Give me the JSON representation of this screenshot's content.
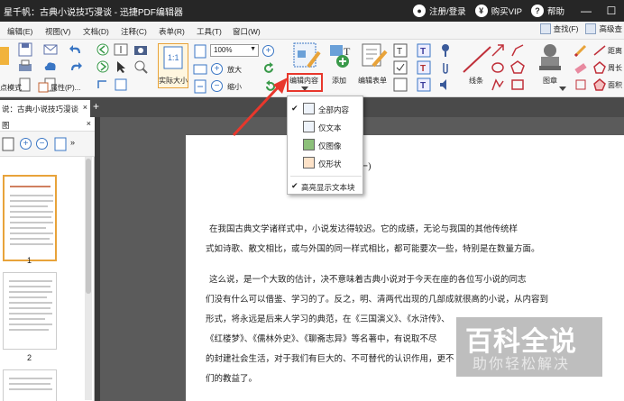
{
  "title_bar": {
    "title": "星千帆：古典小说技巧漫谈 - 迅捷PDF编辑器",
    "login": "注册/登录",
    "vip": "购买VIP",
    "help": "帮助",
    "minimize": "—",
    "maximize": "☐",
    "close": "✕"
  },
  "menu": {
    "items": [
      "编辑(E)",
      "视图(V)",
      "文档(D)",
      "注释(C)",
      "表单(R)",
      "工具(T)",
      "窗口(W)"
    ],
    "find": "查找(F)",
    "advanced_find": "高级查"
  },
  "ribbon": {
    "zoom_value": "100%",
    "zoom_in": "放大",
    "zoom_out": "缩小",
    "actual_size": "实际大小",
    "edit_content": "编辑内容",
    "add": "添加",
    "edit_form": "编辑表单",
    "line": "线条",
    "stamp": "图章",
    "distance": "距离",
    "perimeter": "周长",
    "area": "面积",
    "snapshot_mode": "点模式",
    "properties": "属性(P)..."
  },
  "tab": {
    "label": "说：古典小说技巧漫谈",
    "close": "×"
  },
  "sidebar": {
    "title": "图",
    "close": "×",
    "page1": "1",
    "page2": "2"
  },
  "dropdown": {
    "items": [
      "全部内容",
      "仅文本",
      "仅图像",
      "仅形状"
    ],
    "highlight": "高亮显示文本块"
  },
  "document": {
    "heading": "(一)",
    "lines": [
      "在我国古典文学诸样式中，小说发达得较迟。它的成绩，无论与我国的其他传统样",
      "式如诗歌、散文相比，或与外国的同一样式相比，都可能要次一些，特别是在数量方面。",
      "这么说，是一个大致的估计，决不意味着古典小说对于今天在座的各位写小说的同志",
      "们没有什么可以借鉴、学习的了。反之，明、清两代出现的几部成就很高的小说，从内容到",
      "形式，将永远是后来人学习的典范，在《三国演义》、《水浒传》、",
      "《红楼梦》、《儒林外史》、《聊斋志异》等名著中，有说取不尽",
      "的封建社会生活，对于我们有巨大的、不可替代的认识作用，更不",
      "们的教益了。"
    ]
  },
  "watermark": {
    "big": "百科全说",
    "small": "助你轻松解决"
  },
  "colors": {
    "accent_red": "#e8372c",
    "titlebar": "#262626"
  }
}
